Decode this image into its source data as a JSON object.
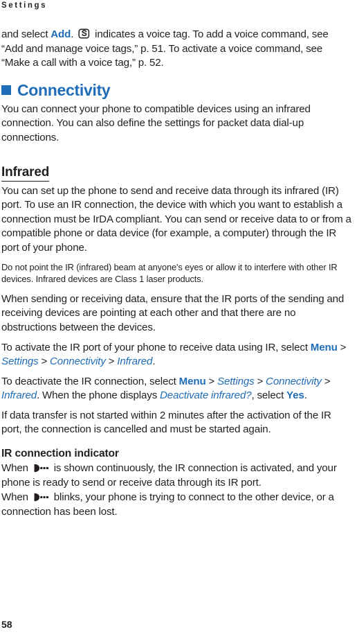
{
  "header": {
    "running_title": "Settings"
  },
  "colors": {
    "accent_blue": "#1f6cb8",
    "body_text": "#231f20",
    "page_background": "#ffffff"
  },
  "icons": {
    "voice_tag": "voice-tag-icon",
    "ir_indicator": "ir-connection-icon"
  },
  "content": {
    "para_voice_tag": {
      "lead": "and select ",
      "ui_add": "Add",
      "after_add": ". ",
      "after_icon": " indicates a voice tag. To add a voice command, see “Add and manage voice tags,” p. 51. To activate a voice command, see “Make a call with a voice tag,” p. 52."
    },
    "heading_connectivity": "Connectivity",
    "para_connectivity": "You can connect your phone to compatible devices using an infrared connection. You can also define the settings for packet data dial-up connections.",
    "heading_infrared": "Infrared",
    "para_infrared_1": "You can set up the phone to send and receive data through its infrared (IR) port. To use an IR connection, the device with which you want to establish a connection must be IrDA compliant. You can send or receive data to or from a compatible phone or data device (for example, a computer) through the IR port of your phone.",
    "note_laser": "Do not point the IR (infrared) beam at anyone's eyes or allow it to interfere with other IR devices. Infrared devices are Class 1 laser products.",
    "para_infrared_2": "When sending or receiving data, ensure that the IR ports of the sending and receiving devices are pointing at each other and that there are no obstructions between the devices.",
    "para_activate": {
      "lead": "To activate the IR port of your phone to receive data using IR, select ",
      "path": [
        {
          "text": "Menu",
          "style": "bold"
        },
        {
          "text": " > ",
          "style": "plain"
        },
        {
          "text": "Settings",
          "style": "italic"
        },
        {
          "text": " > ",
          "style": "plain"
        },
        {
          "text": "Connectivity",
          "style": "italic"
        },
        {
          "text": " > ",
          "style": "plain"
        },
        {
          "text": "Infrared",
          "style": "italic"
        }
      ],
      "tail": "."
    },
    "para_deactivate": {
      "lead": "To deactivate the IR connection, select ",
      "path": [
        {
          "text": "Menu",
          "style": "bold"
        },
        {
          "text": " > ",
          "style": "plain"
        },
        {
          "text": "Settings",
          "style": "italic"
        },
        {
          "text": " > ",
          "style": "plain"
        },
        {
          "text": "Connectivity",
          "style": "italic"
        },
        {
          "text": " > ",
          "style": "plain"
        },
        {
          "text": "Infrared",
          "style": "italic"
        }
      ],
      "middle": ". When the phone displays ",
      "prompt": "Deactivate infrared?",
      "before_yes": ", select ",
      "ui_yes": "Yes",
      "tail": "."
    },
    "para_timeout": "If data transfer is not started within 2 minutes after the activation of the IR port, the connection is cancelled and must be started again.",
    "heading_ir_indicator": "IR connection indicator",
    "para_ir_steady": {
      "lead": "When ",
      "tail": " is shown continuously, the IR connection is activated, and your phone is ready to send or receive data through its IR port."
    },
    "para_ir_blink": {
      "lead": "When ",
      "tail": " blinks, your phone is trying to connect to the other device, or a connection has been lost."
    }
  },
  "footer": {
    "page_number": "58"
  }
}
